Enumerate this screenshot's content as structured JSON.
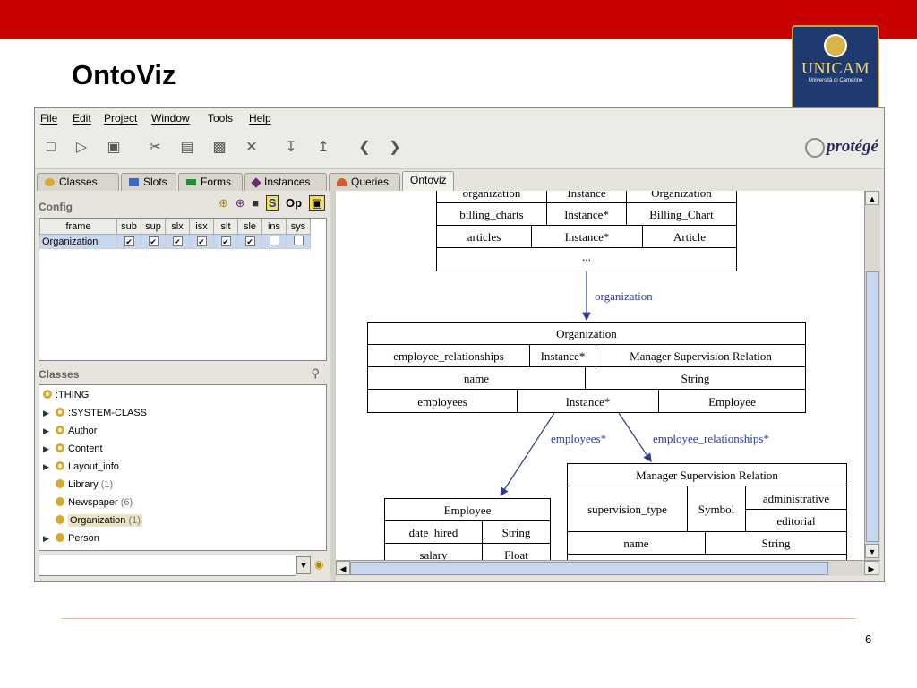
{
  "slide": {
    "title": "OntoViz",
    "page_number": "6"
  },
  "logo": {
    "name": "UNICAM",
    "sub": "Università di Camerino"
  },
  "menu": [
    "File",
    "Edit",
    "Project",
    "Window",
    "Tools",
    "Help"
  ],
  "toolbar": {
    "icons": [
      "new-file-icon",
      "open-folder-icon",
      "save-icon",
      "cut-icon",
      "copy-icon",
      "paste-icon",
      "delete-icon",
      "import-icon",
      "export-icon",
      "back-icon",
      "forward-icon"
    ],
    "brand": "protégé"
  },
  "tabs": [
    {
      "label": "Classes",
      "icon": "class-icon",
      "color": "#d7a92c"
    },
    {
      "label": "Slots",
      "icon": "slot-icon",
      "color": "#3a6ac8"
    },
    {
      "label": "Forms",
      "icon": "form-icon",
      "color": "#2a8a3a"
    },
    {
      "label": "Instances",
      "icon": "instance-icon",
      "color": "#6a2a7a"
    },
    {
      "label": "Queries",
      "icon": "query-icon",
      "color": "#d85a20"
    },
    {
      "label": "Ontoviz",
      "active": true
    }
  ],
  "config": {
    "title": "Config",
    "columns": [
      "frame",
      "sub",
      "sup",
      "slx",
      "isx",
      "slt",
      "sle",
      "ins",
      "sys"
    ],
    "rows": [
      {
        "frame": "Organization",
        "checks": [
          true,
          true,
          true,
          true,
          true,
          true,
          false,
          false
        ]
      }
    ],
    "icon_labels": {
      "s_button": "S",
      "op_button": "Op"
    }
  },
  "classes": {
    "title": "Classes",
    "items": [
      {
        "label": ":THING",
        "count": "",
        "expander": false,
        "ring": true
      },
      {
        "label": ":SYSTEM-CLASS",
        "count": "",
        "expander": true,
        "ring": true
      },
      {
        "label": "Author",
        "count": "",
        "expander": true,
        "ring": true
      },
      {
        "label": "Content",
        "count": "",
        "expander": true,
        "ring": true
      },
      {
        "label": "Layout_info",
        "count": "",
        "expander": true,
        "ring": true
      },
      {
        "label": "Library",
        "count": "(1)",
        "expander": false,
        "ring": false
      },
      {
        "label": "Newspaper",
        "count": "(6)",
        "expander": false,
        "ring": false
      },
      {
        "label": "Organization",
        "count": "(1)",
        "expander": false,
        "ring": false,
        "selected": true
      },
      {
        "label": "Person",
        "count": "",
        "expander": true,
        "ring": false
      }
    ]
  },
  "graph": {
    "top_table": {
      "rows": [
        [
          "organization",
          "Instance",
          "Organization"
        ],
        [
          "billing_charts",
          "Instance*",
          "Billing_Chart"
        ],
        [
          "articles",
          "Instance*",
          "Article"
        ],
        [
          "...",
          "",
          ""
        ]
      ]
    },
    "edge_organization": "organization",
    "organization_table": {
      "title": "Organization",
      "rows": [
        [
          "employee_relationships",
          "Instance*",
          "Manager Supervision Relation"
        ],
        [
          "name",
          "String"
        ],
        [
          "employees",
          "Instance*",
          "Employee"
        ]
      ]
    },
    "edge_employees": "employees*",
    "edge_employee_relationships": "employee_relationships*",
    "employee_table": {
      "title": "Employee",
      "rows": [
        [
          "date_hired",
          "String"
        ],
        [
          "salary",
          "Float"
        ]
      ]
    },
    "msr_table": {
      "title": "Manager Supervision Relation",
      "supervision_type": "supervision_type",
      "symbol": "Symbol",
      "values": [
        "administrative",
        "editorial"
      ],
      "name_row": [
        "name",
        "String"
      ]
    }
  }
}
